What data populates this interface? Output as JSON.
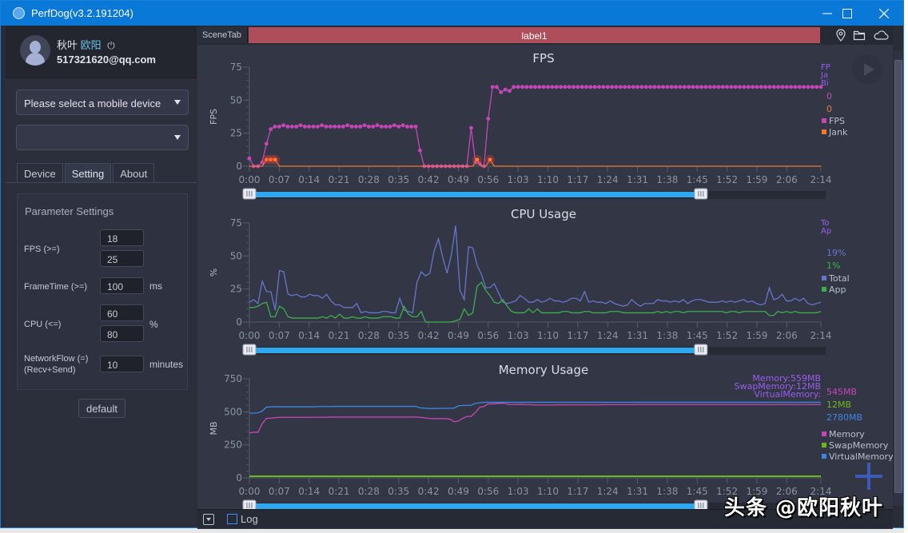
{
  "window": {
    "title": "PerfDog(v3.2.191204)",
    "minimize": "—",
    "maximize": "☐",
    "close": "✕"
  },
  "user": {
    "name_part1": "秋叶",
    "name_part2": "欧阳",
    "power_icon": "⏻",
    "email": "517321620@qq.com"
  },
  "device_select": {
    "value": "Please select a mobile device"
  },
  "app_select": {
    "value": ""
  },
  "tabs": [
    {
      "label": "Device"
    },
    {
      "label": "Setting"
    },
    {
      "label": "About"
    }
  ],
  "params": {
    "title": "Parameter Settings",
    "fps_label": "FPS (>=)",
    "fps_values": [
      "18",
      "25"
    ],
    "frametime_label": "FrameTime (>=)",
    "frametime_value": "100",
    "frametime_unit": "ms",
    "cpu_label": "CPU (<=)",
    "cpu_values": [
      "60",
      "80"
    ],
    "cpu_unit": "%",
    "network_label1": "NetworkFlow (=)",
    "network_label2": "(Recv+Send)",
    "network_value": "10",
    "network_unit": "minutes",
    "default_button": "default"
  },
  "scene": {
    "tab": "SceneTab",
    "label": "label1",
    "color": "#ad4e5a"
  },
  "bottom": {
    "log_label": "Log"
  },
  "watermark": "头条 @欧阳秋叶",
  "x_ticks": [
    "0:00",
    "0:07",
    "0:14",
    "0:21",
    "0:28",
    "0:35",
    "0:42",
    "0:49",
    "0:56",
    "1:03",
    "1:10",
    "1:17",
    "1:24",
    "1:31",
    "1:38",
    "1:45",
    "1:52",
    "1:59",
    "2:06",
    "2:14"
  ],
  "slider": {
    "start_fraction": 0.0,
    "end_fraction": 0.79
  },
  "chart_data": [
    {
      "type": "line",
      "title": "FPS",
      "xlabel": "",
      "ylabel": "FPS",
      "ylim": [
        0,
        75
      ],
      "yticks": [
        0,
        25,
        50,
        75
      ],
      "x_range_seconds": [
        0,
        134
      ],
      "cursor_labels": [
        "FPS",
        "Jank",
        "BigJank"
      ],
      "current_values": [
        {
          "text": "0",
          "color": "#c646b8"
        },
        {
          "text": "0",
          "color": "#f07a2a"
        }
      ],
      "legend": [
        {
          "name": "FPS",
          "color": "#c646b8"
        },
        {
          "name": "Jank",
          "color": "#f07a2a"
        }
      ],
      "series": [
        {
          "name": "FPS",
          "color": "#c646b8",
          "markers": true,
          "values": [
            6,
            0,
            0,
            3,
            17,
            28,
            30,
            30,
            31,
            30,
            30,
            30,
            31,
            30,
            30,
            30,
            30,
            31,
            30,
            30,
            30,
            30,
            30,
            31,
            30,
            30,
            30,
            31,
            30,
            30,
            31,
            30,
            30,
            30,
            31,
            30,
            31,
            30,
            30,
            30,
            12,
            0,
            0,
            0,
            0,
            0,
            0,
            0,
            0,
            0,
            0,
            0,
            29,
            3,
            2,
            0,
            36,
            60,
            60,
            56,
            58,
            57,
            60,
            60,
            60,
            60,
            60,
            60,
            60,
            60,
            60,
            60,
            60,
            60,
            60,
            60,
            60,
            60,
            60,
            60,
            60,
            60,
            60,
            60,
            60,
            60,
            60,
            60,
            60,
            60,
            60,
            60,
            60,
            60,
            60,
            60,
            60,
            60,
            60,
            60,
            60,
            60,
            60,
            60,
            60,
            60,
            60,
            60,
            60,
            60,
            60,
            60,
            60,
            60,
            60,
            60,
            60,
            60,
            60,
            60,
            60,
            60,
            60,
            60,
            60,
            60,
            60,
            60,
            60,
            60,
            60,
            60,
            60,
            60,
            60
          ]
        },
        {
          "name": "Jank",
          "color": "#f07a2a",
          "markers": false,
          "values": [
            0,
            0,
            0,
            0,
            5,
            5,
            5,
            0,
            0,
            0,
            0,
            0,
            0,
            0,
            0,
            0,
            0,
            0,
            0,
            0,
            0,
            0,
            0,
            0,
            0,
            0,
            0,
            0,
            0,
            0,
            0,
            0,
            0,
            0,
            0,
            0,
            0,
            0,
            0,
            0,
            0,
            0,
            0,
            0,
            0,
            0,
            0,
            0,
            0,
            0,
            0,
            0,
            0,
            5,
            0,
            0,
            5,
            0,
            0,
            0,
            0,
            0,
            0,
            0,
            0,
            0,
            0,
            0,
            0,
            0,
            0,
            0,
            0,
            0,
            0,
            0,
            0,
            0,
            0,
            0,
            0,
            0,
            0,
            0,
            0,
            0,
            0,
            0,
            0,
            0,
            0,
            0,
            0,
            0,
            0,
            0,
            0,
            0,
            0,
            0,
            0,
            0,
            0,
            0,
            0,
            0,
            0,
            0,
            0,
            0,
            0,
            0,
            0,
            0,
            0,
            0,
            0,
            0,
            0,
            0,
            0,
            0,
            0,
            0,
            0,
            0,
            0,
            0,
            0,
            0,
            0,
            0,
            0,
            0
          ]
        }
      ]
    },
    {
      "type": "line",
      "title": "CPU Usage",
      "xlabel": "",
      "ylabel": "%",
      "ylim": [
        0,
        75
      ],
      "yticks": [
        0,
        25,
        50,
        75
      ],
      "x_range_seconds": [
        0,
        134
      ],
      "cursor_labels": [
        "TotalCPU",
        "AppCPU"
      ],
      "current_values": [
        {
          "text": "19%",
          "color": "#6675cc"
        },
        {
          "text": "1%",
          "color": "#3dae4d"
        }
      ],
      "legend": [
        {
          "name": "Total",
          "color": "#6675cc"
        },
        {
          "name": "App",
          "color": "#3dae4d"
        }
      ],
      "series": [
        {
          "name": "Total",
          "color": "#6675cc",
          "values": [
            15,
            17,
            14,
            31,
            23,
            23,
            9,
            39,
            38,
            21,
            20,
            21,
            19,
            19,
            21,
            20,
            20,
            18,
            21,
            16,
            13,
            13,
            11,
            11,
            11,
            14,
            7,
            8,
            7,
            7,
            7,
            8,
            8,
            7,
            7,
            18,
            9,
            8,
            7,
            30,
            38,
            35,
            37,
            54,
            63,
            49,
            37,
            51,
            73,
            24,
            17,
            57,
            56,
            43,
            36,
            26,
            26,
            29,
            22,
            15,
            14,
            15,
            16,
            20,
            18,
            15,
            15,
            17,
            15,
            16,
            18,
            16,
            16,
            15,
            16,
            18,
            18,
            16,
            23,
            15,
            16,
            15,
            15,
            14,
            16,
            14,
            13,
            12,
            13,
            17,
            14,
            12,
            14,
            14,
            14,
            17,
            16,
            16,
            15,
            16,
            15,
            17,
            14,
            16,
            17,
            17,
            16,
            15,
            15,
            15,
            16,
            15,
            16,
            15,
            16,
            17,
            15,
            16,
            14,
            13,
            14,
            26,
            17,
            18,
            21,
            16,
            16,
            18,
            16,
            18,
            14,
            13,
            14,
            15
          ]
        },
        {
          "name": "App",
          "color": "#3dae4d",
          "values": [
            11,
            11,
            12,
            14,
            15,
            4,
            4,
            12,
            10,
            4,
            3,
            3,
            3,
            3,
            3,
            3,
            3,
            4,
            3,
            5,
            3,
            6,
            3,
            3,
            4,
            3,
            3,
            4,
            3,
            3,
            3,
            4,
            4,
            4,
            3,
            3,
            12,
            6,
            4,
            4,
            8,
            0,
            0,
            0,
            0,
            0,
            0,
            0,
            1,
            2,
            10,
            5,
            7,
            27,
            30,
            24,
            20,
            15,
            14,
            17,
            12,
            8,
            7,
            7,
            7,
            10,
            7,
            10,
            7,
            7,
            7,
            7,
            7,
            8,
            8,
            7,
            7,
            7,
            8,
            8,
            7,
            7,
            7,
            7,
            8,
            8,
            8,
            7,
            7,
            7,
            7,
            7,
            7,
            7,
            7,
            8,
            7,
            8,
            7,
            8,
            8,
            7,
            8,
            8,
            8,
            8,
            8,
            8,
            8,
            8,
            8,
            7,
            8,
            8,
            7,
            8,
            8,
            8,
            8,
            8,
            8,
            5,
            5,
            8,
            7,
            8,
            7,
            8,
            7,
            7,
            7,
            7,
            7,
            8
          ]
        }
      ]
    },
    {
      "type": "line",
      "title": "Memory Usage",
      "xlabel": "",
      "ylabel": "MB",
      "ylim": [
        0,
        750
      ],
      "yticks": [
        0,
        250,
        500,
        750
      ],
      "x_range_seconds": [
        0,
        134
      ],
      "cursor_labels": [
        "Memory:559MB",
        "SwapMemory:12MB",
        "VirtualMemory:"
      ],
      "current_values": [
        {
          "text": "545MB",
          "color": "#c646b8"
        },
        {
          "text": "12MB",
          "color": "#6fb51e"
        },
        {
          "text": "2780MB",
          "color": "#3d86e0"
        }
      ],
      "legend": [
        {
          "name": "Memory",
          "color": "#c646b8"
        },
        {
          "name": "SwapMemory",
          "color": "#6fb51e"
        },
        {
          "name": "VirtualMemory",
          "color": "#3d86e0"
        }
      ],
      "series": [
        {
          "name": "Memory",
          "color": "#c646b8",
          "values": [
            340,
            345,
            345,
            410,
            450,
            452,
            455,
            458,
            458,
            458,
            458,
            458,
            458,
            458,
            458,
            459,
            459,
            459,
            459,
            460,
            460,
            460,
            460,
            460,
            460,
            460,
            460,
            460,
            460,
            460,
            460,
            460,
            460,
            460,
            460,
            460,
            460,
            460,
            460,
            460,
            458,
            455,
            450,
            448,
            448,
            448,
            448,
            445,
            425,
            430,
            450,
            465,
            465,
            495,
            535,
            540,
            560,
            560,
            562,
            565,
            562,
            555,
            555,
            556,
            556,
            554,
            554,
            552,
            552,
            552,
            552,
            552,
            553,
            553,
            553,
            553,
            553,
            553,
            553,
            553,
            553,
            553,
            553,
            554,
            554,
            554,
            554,
            554,
            554,
            554,
            554,
            555,
            555,
            555,
            555,
            555,
            555,
            555,
            555,
            555,
            555,
            555,
            555,
            555,
            555,
            555,
            555,
            555,
            555,
            555,
            555,
            555,
            555,
            555,
            555,
            555,
            555,
            555,
            555,
            555,
            555,
            555,
            555,
            555,
            555,
            555,
            555,
            555,
            555,
            555,
            555,
            555,
            555,
            555,
            555
          ]
        },
        {
          "name": "SwapMemory",
          "color": "#6fb51e",
          "values": [
            12,
            12,
            12,
            12,
            12,
            12,
            12,
            12,
            12,
            12,
            12,
            12,
            12,
            12,
            12,
            12,
            12,
            12,
            12,
            12,
            12,
            12,
            12,
            12,
            12,
            12,
            12,
            12,
            12,
            12,
            12,
            12,
            12,
            12,
            12,
            12,
            12,
            12,
            12,
            12,
            12,
            12,
            12,
            12,
            12,
            12,
            12,
            12,
            12,
            12,
            12,
            12,
            12,
            12,
            12,
            12,
            12,
            12,
            12,
            12,
            12,
            12,
            12,
            12,
            12,
            12,
            12,
            12,
            12,
            12,
            12,
            12,
            12,
            12,
            12,
            12,
            12,
            12,
            12,
            12,
            12,
            12,
            12,
            12,
            12,
            12,
            12,
            12,
            12,
            12,
            12,
            12,
            12,
            12,
            12,
            12,
            12,
            12,
            12,
            12,
            12,
            12,
            12,
            12,
            12,
            12,
            12,
            12,
            12,
            12,
            12,
            12,
            12,
            12,
            12,
            12,
            12,
            12,
            12,
            12,
            12,
            12,
            12,
            12,
            12,
            12,
            12,
            12,
            12,
            12,
            12,
            12,
            12,
            12,
            12
          ]
        },
        {
          "name": "VirtualMemory",
          "color": "#3d86e0",
          "values": [
            490,
            490,
            492,
            505,
            535,
            538,
            538,
            538,
            538,
            538,
            538,
            538,
            538,
            538,
            538,
            538,
            540,
            540,
            540,
            540,
            541,
            541,
            541,
            541,
            541,
            541,
            541,
            541,
            541,
            541,
            541,
            541,
            541,
            541,
            541,
            541,
            541,
            541,
            541,
            541,
            530,
            528,
            525,
            525,
            525,
            526,
            526,
            527,
            528,
            545,
            548,
            548,
            550,
            565,
            568,
            572,
            572,
            572,
            572,
            572,
            572,
            572,
            572,
            572,
            572,
            572,
            572,
            572,
            572,
            572,
            572,
            572,
            572,
            572,
            572,
            572,
            572,
            572,
            572,
            572,
            572,
            572,
            572,
            572,
            572,
            572,
            572,
            572,
            572,
            572,
            572,
            572,
            572,
            572,
            572,
            572,
            572,
            572,
            572,
            572,
            572,
            572,
            572,
            572,
            572,
            572,
            572,
            572,
            572,
            572,
            572,
            572,
            572,
            572,
            572,
            572,
            572,
            572,
            572,
            572,
            572,
            572,
            572,
            572,
            572,
            572,
            572,
            572,
            572,
            572,
            572,
            572,
            572,
            572,
            572
          ]
        }
      ]
    }
  ]
}
